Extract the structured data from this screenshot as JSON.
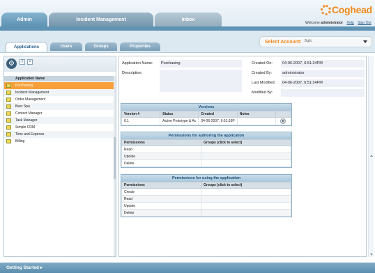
{
  "top_tabs": [
    "Admin",
    "Incident Management",
    "Inbox"
  ],
  "brand": "Coghead",
  "welcome": {
    "prefix": "Welcome",
    "user": "administrator",
    "help": "Help",
    "sign_out": "Sign Out"
  },
  "sub_tabs": [
    "Applications",
    "Users",
    "Groups",
    "Properties"
  ],
  "account": {
    "label": "Select Account:",
    "value": "Bgllc"
  },
  "app_list": {
    "header": "Application Name",
    "items": [
      "Purchasing",
      "Incident Management",
      "Order Management",
      "Beer Spa",
      "Contact Manager",
      "Task Manager",
      "Simple CRM",
      "Time and Expense",
      "Billing"
    ],
    "selected_index": 0
  },
  "details": {
    "name_label": "Application Name:",
    "name_value": "Purchasing",
    "description_label": "Description:",
    "created_on_label": "Created On:",
    "created_on_value": "04-06-2007, 6:51:34PM",
    "created_by_label": "Created By:",
    "created_by_value": "administrator",
    "last_modified_label": "Last Modified:",
    "last_modified_value": "04-06-2007, 6:51:34PM",
    "modified_by_label": "Modified By:"
  },
  "versions": {
    "title": "Versions",
    "columns": [
      "Version #",
      "Status",
      "Created",
      "Notes"
    ],
    "rows": [
      {
        "version": "0.1",
        "status": "Active Prototype & Ac",
        "created": "04-06-2007, 6:51:55P",
        "notes": ""
      }
    ]
  },
  "perm_authoring": {
    "title": "Permissions for authoring the application",
    "columns": [
      "Permissions",
      "Groups (click to select)"
    ],
    "rows": [
      "Read",
      "Update",
      "Delete"
    ]
  },
  "perm_using": {
    "title": "Permissions for using the application",
    "columns": [
      "Permissions",
      "Groups (click to select)"
    ],
    "rows": [
      "Create",
      "Read",
      "Update",
      "Delete"
    ]
  },
  "footer": "Getting Started ▸"
}
